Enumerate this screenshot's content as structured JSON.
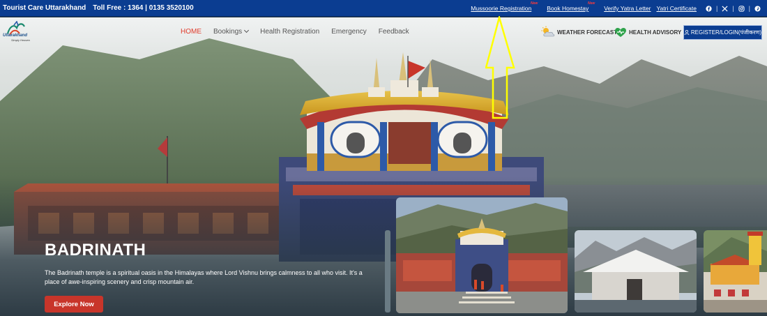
{
  "topbar": {
    "brand": "Tourist Care Uttarakhand",
    "tollfree": "Toll Free : 1364 | 0135 3520100",
    "links": [
      {
        "label": "Mussoorie Registration",
        "badge": "New"
      },
      {
        "label": "Book Homestay",
        "badge": "New"
      },
      {
        "label": "Verify Yatra Letter",
        "badge": ""
      },
      {
        "label": "Yatri Certificate",
        "badge": ""
      }
    ],
    "social_icons": [
      "facebook-icon",
      "x-icon",
      "instagram-icon",
      "pinterest-icon"
    ]
  },
  "logo": {
    "title": "Uttarakhand",
    "subtitle": "Simply Heaven"
  },
  "nav": {
    "items": [
      {
        "label": "HOME",
        "active": true
      },
      {
        "label": "Bookings",
        "dropdown": true
      },
      {
        "label": "Health Registration"
      },
      {
        "label": "Emergency"
      },
      {
        "label": "Feedback"
      }
    ],
    "weather": "WEATHER FORECAST",
    "health": "HEALTH ADVISORY",
    "register": "REGISTER/LOGIN(पंजीकरण)"
  },
  "hero": {
    "title": "BADRINATH",
    "description": "The Badrinath temple is a spiritual oasis in the Himalayas where Lord Vishnu brings calmness to all who visit. It's a place of awe-inspiring scenery and crisp mountain air.",
    "button": "Explore Now"
  },
  "colors": {
    "topbar": "#0b3d91",
    "accent_red": "#e03a2a",
    "button_red": "#c8352a",
    "arrow_yellow": "#ffff00"
  }
}
